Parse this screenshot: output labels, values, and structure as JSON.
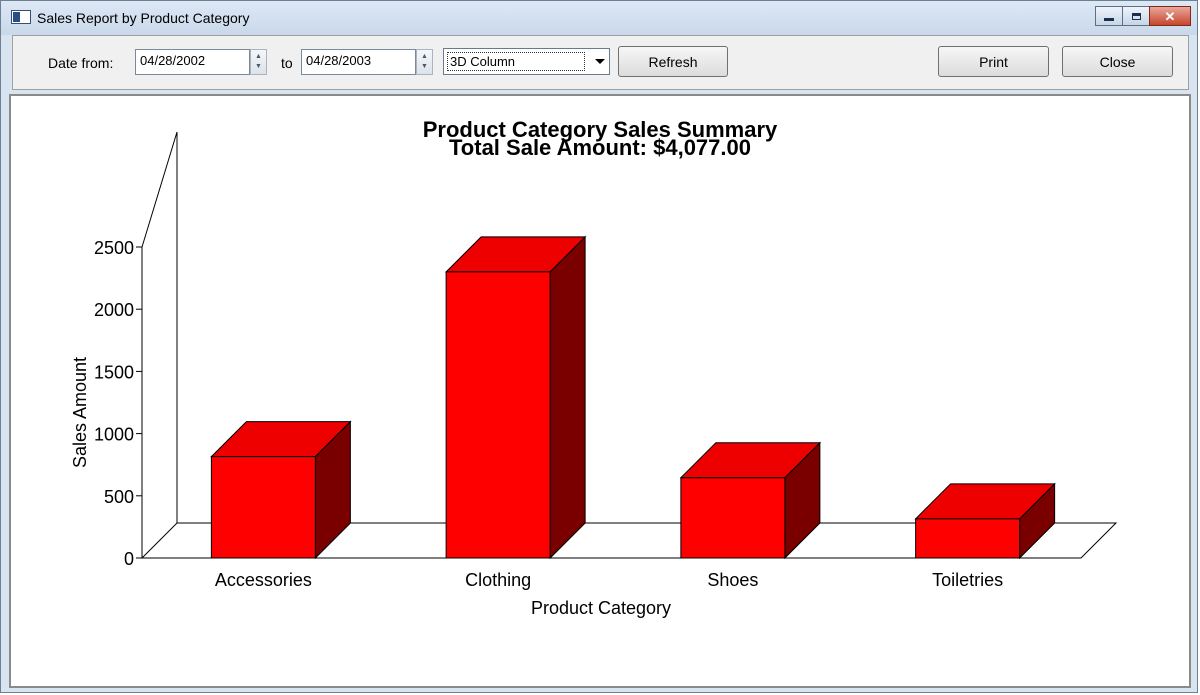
{
  "window": {
    "title": "Sales Report by Product Category"
  },
  "toolbar": {
    "date_from_label": "Date from:",
    "date_from_value": "04/28/2002",
    "to_label": "to",
    "date_to_value": "04/28/2003",
    "chart_type_selected": "3D Column",
    "refresh_label": "Refresh",
    "print_label": "Print",
    "close_label": "Close"
  },
  "colors": {
    "bar_front": "#ff0000",
    "bar_top": "#ee0000",
    "bar_side": "#7a0000"
  },
  "chart_data": {
    "type": "bar",
    "title": "Product Category Sales Summary",
    "subtitle": "Total Sale Amount:  $4,077.00",
    "xlabel": "Product Category",
    "ylabel": "Sales Amount",
    "categories": [
      "Accessories",
      "Clothing",
      "Shoes",
      "Toiletries"
    ],
    "values": [
      815,
      2300,
      645,
      315
    ],
    "ylim": [
      0,
      2500
    ],
    "yticks": [
      0,
      500,
      1000,
      1500,
      2000,
      2500
    ],
    "style": "3d"
  }
}
